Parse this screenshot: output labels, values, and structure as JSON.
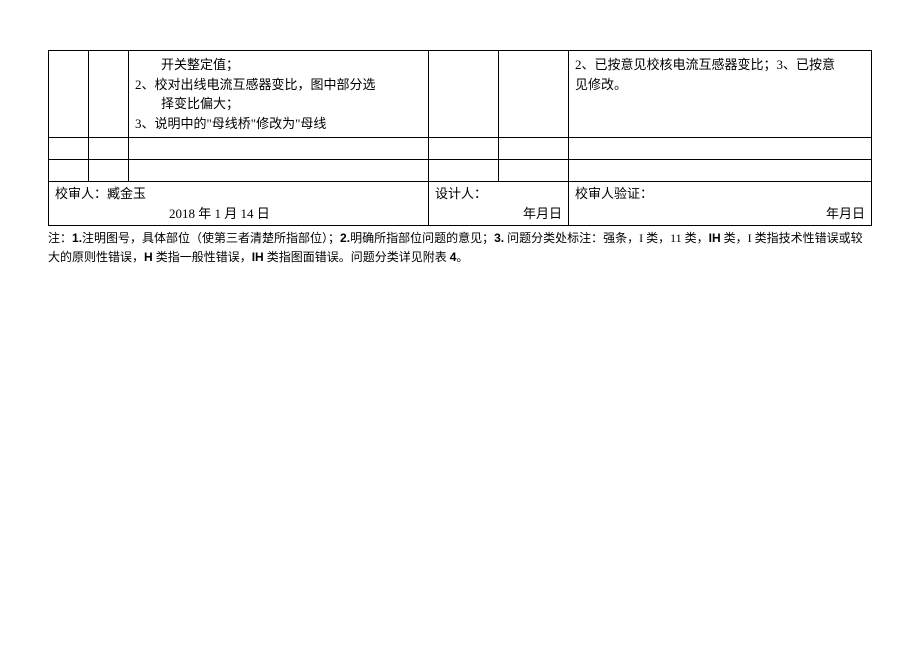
{
  "row1": {
    "col3_line1": "开关整定值；",
    "col3_line2": "2、校对出线电流互感器变比，图中部分选",
    "col3_line3": "择变比偏大；",
    "col3_line4": "3、说明中的\"母线桥\"修改为\"母线",
    "col6_line1": "2、已按意见校核电流互感器变比；3、已按意",
    "col6_line2": "见修改。"
  },
  "signature": {
    "reviewer_label": "校审人：臧金玉",
    "designer_label": "设计人：",
    "verify_label": "校审人验证：",
    "date1": "2018 年 1 月 14 日",
    "date2": "年月日",
    "date3": "年月日"
  },
  "footnote": {
    "prefix": "注：",
    "p1_label": "1.",
    "p1": "注明图号，具体部位（使第三者清楚所指部位）；",
    "p2_label": "2.",
    "p2": "明确所指部位问题的意见；",
    "p3_label": "3.",
    "p3": " 问题分类处标注：强条，I 类，11 类，",
    "ih1": "IH",
    "p3b": " 类，I 类指技术性错误或较大的原则性错误，",
    "h": "H",
    "p4": " 类指一般性错误，",
    "ih2": "IH",
    "p5": " 类指图面错误。问题分类详见附表 ",
    "p6": "4",
    "p7": "。"
  }
}
